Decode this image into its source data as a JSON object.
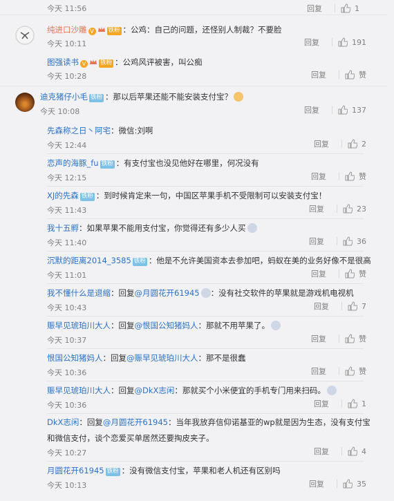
{
  "comments": [
    {
      "id": "c0",
      "text": "",
      "time": "今天 11:56",
      "reply": "回复",
      "likes": "1"
    },
    {
      "id": "c1",
      "user": "纯进口沙雕",
      "badge": "铁粉",
      "text": "：公鸡：自己的问题，还怪别人制裁？不要脸",
      "time": "今天 10:11",
      "reply": "回复",
      "likes": "191"
    },
    {
      "id": "c2",
      "user": "图强读书",
      "badge": "铁粉",
      "text": "：公鸡风评被害，叫公痴",
      "time": "今天 10:28",
      "reply": "回复",
      "likes": "赞"
    },
    {
      "id": "c3",
      "user": "迪克猪仔小毛",
      "badge": "铁粉",
      "text": "：那以后苹果还能不能安装支付宝？",
      "time": "今天 10:08",
      "reply": "回复",
      "likes": "137"
    },
    {
      "id": "c4",
      "user": "先森称之日丶阿宅",
      "text": "：微信:刘啊",
      "time": "今天 12:44",
      "reply": "回复",
      "likes": "2"
    },
    {
      "id": "c5",
      "user": "恋声的海豚_fu",
      "badge": "铁粉",
      "text": "：有支付宝也没见他好在哪里，何况没有",
      "time": "今天 12:15",
      "reply": "回复",
      "likes": "赞"
    },
    {
      "id": "c6",
      "user": "XJ的先森",
      "badge": "铁粉",
      "text": "：到时候肯定来一句，中国区苹果手机不受限制可以安装支付宝！",
      "time": "今天 11:43",
      "reply": "回复",
      "likes": "23"
    },
    {
      "id": "c7",
      "user": "我十五孵",
      "text": "：如果苹果不能用支付宝，你觉得还有多少人买",
      "time": "今天 11:40",
      "reply": "回复",
      "likes": "36"
    },
    {
      "id": "c8",
      "user": "沉默的距离2014_3585",
      "badge": "铁粉",
      "text": "：他是不允许美国资本去参加吧，蚂蚁在美的业务好像不是很高",
      "time": "今天 11:01",
      "reply": "回复",
      "likes": "赞"
    },
    {
      "id": "c9",
      "user": "我不懂什么是退缩",
      "prefix": "：回复",
      "mention": "@月圆花开61945",
      "text": "：没有社交软件的苹果就是游戏机电视机",
      "time": "今天 10:43",
      "reply": "回复",
      "likes": "7"
    },
    {
      "id": "c10",
      "user": "赈早见琥珀川大人",
      "prefix": "：回复",
      "mention": "@恨国公知猪妈人",
      "text": "：那就不用苹果了。",
      "time": "今天 10:37",
      "reply": "回复",
      "likes": "赞"
    },
    {
      "id": "c11",
      "user": "恨国公知猪妈人",
      "prefix": "：回复",
      "mention": "@赈早见琥珀川大人",
      "text": "：那不是很蠢",
      "time": "今天 10:36",
      "reply": "回复",
      "likes": "赞"
    },
    {
      "id": "c12",
      "user": "赈早见琥珀川大人",
      "prefix": "：回复",
      "mention": "@DkX志闲",
      "text": "：那就买个小米便宜的手机专门用来扫码。",
      "time": "今天 10:36",
      "reply": "回复",
      "likes": "1"
    },
    {
      "id": "c13",
      "user": "DkX志闲",
      "prefix": "：回复",
      "mention": "@月圆花开61945",
      "text": "：当年我放弃信仰诺基亚的wp就是因为生态，没有支付宝和微信支付，谈个恋爱买单居然还要掏皮夹子。",
      "time": "今天 10:27",
      "reply": "回复",
      "likes": "4"
    },
    {
      "id": "c14",
      "user": "月圆花开61945",
      "badge": "铁粉",
      "text": "：没有微信支付宝，苹果和老人机还有区别吗",
      "time": "今天 10:13",
      "reply": "回复",
      "likes": "35"
    }
  ],
  "colors": {
    "accent": "#eb7350",
    "link": "#2b72c9",
    "muted": "#808080",
    "background": "#f2f2f5"
  }
}
